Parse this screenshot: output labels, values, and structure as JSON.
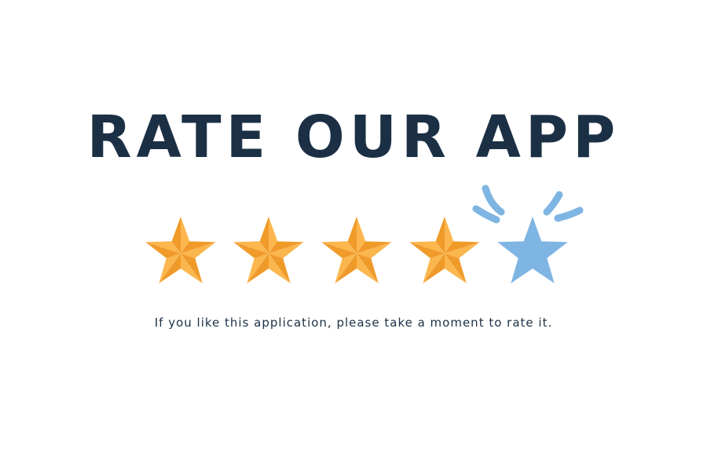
{
  "heading": "RATE OUR APP",
  "message": "If you like this application, please take a moment to rate it.",
  "rating": {
    "value": 4,
    "max": 5
  },
  "stars": [
    {
      "icon": "star-icon",
      "state": "filled"
    },
    {
      "icon": "star-icon",
      "state": "filled"
    },
    {
      "icon": "star-icon",
      "state": "filled"
    },
    {
      "icon": "star-icon",
      "state": "filled"
    },
    {
      "icon": "star-icon",
      "state": "hover"
    }
  ],
  "colors": {
    "heading": "#1c3045",
    "text": "#1c3045",
    "star_filled_light": "#fbb64e",
    "star_filled_dark": "#f09a2a",
    "star_hover": "#7fb5e3",
    "sparkle": "#7fb5e3",
    "background": "#ffffff"
  }
}
